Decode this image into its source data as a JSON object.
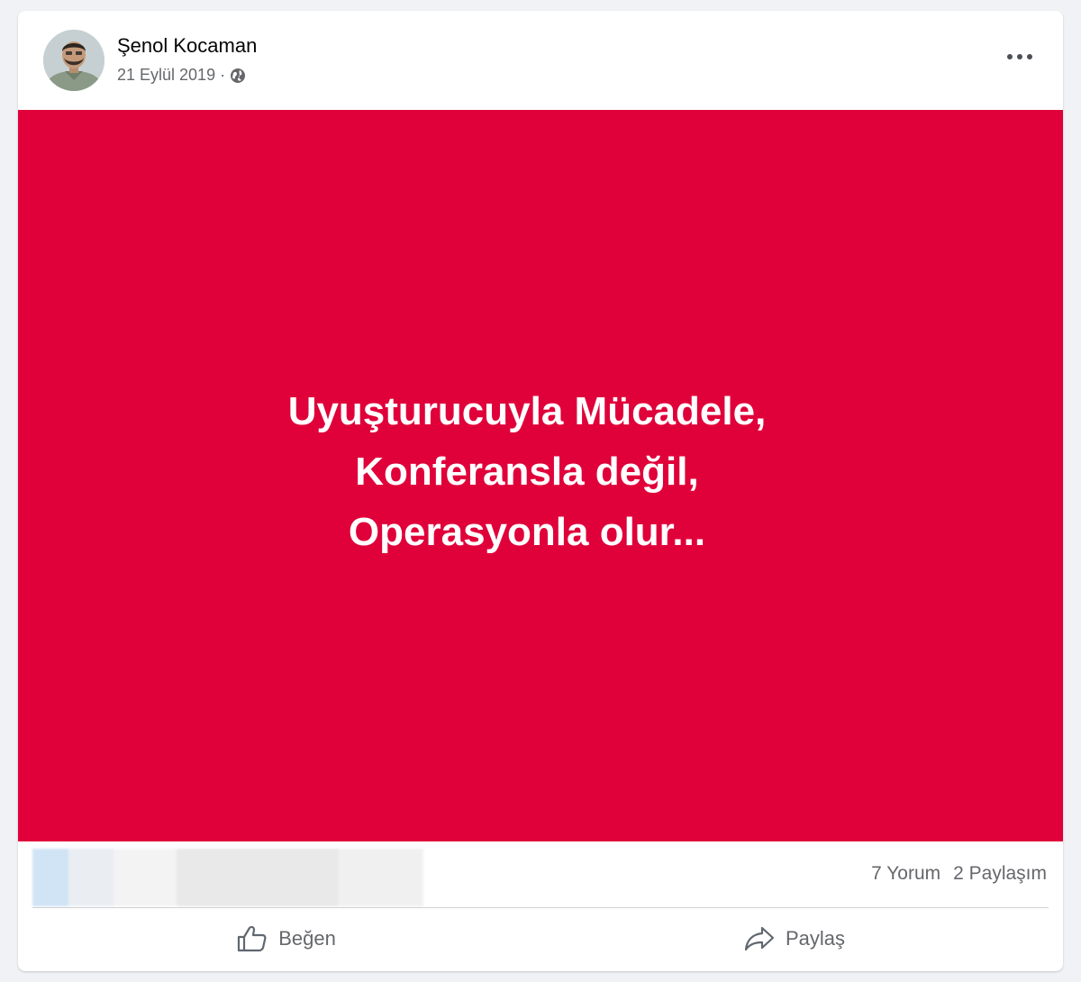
{
  "post": {
    "author": "Şenol Kocaman",
    "date": "21 Eylül 2019",
    "separator": "·",
    "privacy_icon": "globe-icon",
    "more_icon": "more-options-icon",
    "image": {
      "background_color": "#e0003a",
      "text_color": "#ffffff",
      "lines": [
        "Uyuşturucuyla Mücadele,",
        "Konferansla değil,",
        "Operasyonla olur..."
      ]
    },
    "stats": {
      "comments": "7 Yorum",
      "shares": "2 Paylaşım"
    },
    "actions": {
      "like_label": "Beğen",
      "like_icon": "thumbs-up-icon",
      "share_label": "Paylaş",
      "share_icon": "share-arrow-icon"
    }
  }
}
